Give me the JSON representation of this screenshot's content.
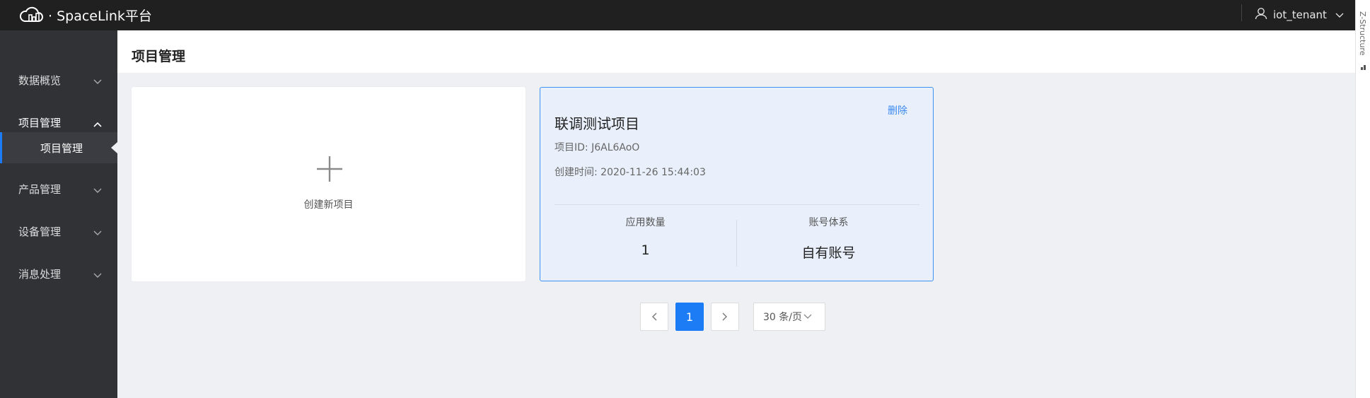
{
  "app": {
    "brand": "· SpaceLink平台"
  },
  "user": {
    "name": "iot_tenant"
  },
  "sidebar": {
    "items": [
      {
        "label": "数据概览"
      },
      {
        "label": "项目管理"
      },
      {
        "label": "项目管理"
      },
      {
        "label": "产品管理"
      },
      {
        "label": "设备管理"
      },
      {
        "label": "消息处理"
      }
    ]
  },
  "page": {
    "title": "项目管理"
  },
  "new_card": {
    "label": "创建新项目"
  },
  "project": {
    "name": "联调测试项目",
    "delete_label": "删除",
    "id_text": "项目ID: J6AL6AoO",
    "created_text": "创建时间: 2020-11-26 15:44:03",
    "stats": [
      {
        "label": "应用数量",
        "value": "1"
      },
      {
        "label": "账号体系",
        "value": "自有账号"
      }
    ]
  },
  "pagination": {
    "current_page": "1",
    "page_size_label": "30 条/页"
  },
  "side_strip": {
    "text": "Z-Structure"
  },
  "colors": {
    "topbar": "#202020",
    "sidebar": "#303236",
    "accent": "#1c7cf6",
    "card_selected_bg": "#e9f0fb"
  },
  "icons": [
    "cloud-logo-icon",
    "user-icon",
    "chevron-down-icon",
    "chevron-up-icon",
    "plus-icon",
    "chevron-left-icon",
    "chevron-right-icon"
  ]
}
